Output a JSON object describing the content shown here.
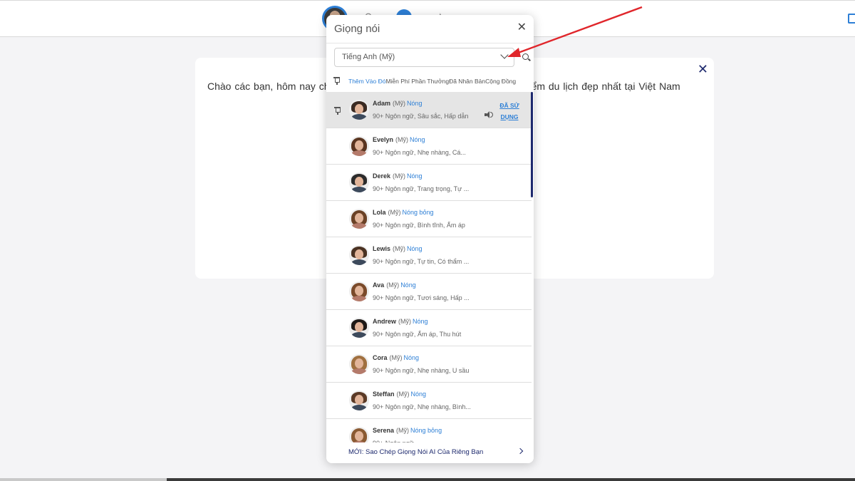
{
  "card": {
    "text": "Chào các bạn, hôm nay chúng ta sẽ cùng nhau khám phá những địa điểm du lịch đẹp nhất tại Việt Nam",
    "close_glyph": "✕"
  },
  "panel": {
    "title": "Giọng nói",
    "close_glyph": "✕",
    "language": "Tiếng Anh (Mỹ)",
    "filters": [
      "Thêm Vào Đó",
      "Miễn Phí",
      "Phần Thưởng",
      "Đã Nhân Bản",
      "Cộng Đồng"
    ],
    "footer": "MỚI: Sao Chép Giọng Nói AI Của Riêng Bạn"
  },
  "voices": [
    {
      "name": "Adam",
      "accent": "(Mỹ)",
      "tone": "Nóng",
      "desc": "90+ Ngôn ngữ, Sâu sắc, Hấp dẫn",
      "status": "ĐÃ SỬ DỤNG",
      "gender": "m",
      "hair": "#3a2a22"
    },
    {
      "name": "Evelyn",
      "accent": "(Mỹ)",
      "tone": "Nóng",
      "desc": "90+ Ngôn ngữ, Nhẹ nhàng, Cá...",
      "gender": "f",
      "hair": "#5a3520"
    },
    {
      "name": "Derek",
      "accent": "(Mỹ)",
      "tone": "Nóng",
      "desc": "90+ Ngôn ngữ, Trang trọng, Tự ...",
      "gender": "m",
      "hair": "#2b2b2b"
    },
    {
      "name": "Lola",
      "accent": "(Mỹ)",
      "tone": "Nóng bỏng",
      "desc": "90+ Ngôn ngữ, Bình tĩnh, Ấm áp",
      "gender": "f",
      "hair": "#6b4226"
    },
    {
      "name": "Lewis",
      "accent": "(Mỹ)",
      "tone": "Nóng",
      "desc": "90+ Ngôn ngữ, Tự tin, Có thẩm ...",
      "gender": "m",
      "hair": "#4a3222"
    },
    {
      "name": "Ava",
      "accent": "(Mỹ)",
      "tone": "Nóng",
      "desc": "90+ Ngôn ngữ, Tươi sáng, Hấp ...",
      "gender": "f",
      "hair": "#7a4a2a"
    },
    {
      "name": "Andrew",
      "accent": "(Mỹ)",
      "tone": "Nóng",
      "desc": "90+ Ngôn ngữ, Ấm áp, Thu hút",
      "gender": "m",
      "hair": "#1f1a17"
    },
    {
      "name": "Cora",
      "accent": "(Mỹ)",
      "tone": "Nóng",
      "desc": "90+ Ngôn ngữ, Nhẹ nhàng, U sầu",
      "gender": "f",
      "hair": "#a0703f"
    },
    {
      "name": "Steffan",
      "accent": "(Mỹ)",
      "tone": "Nóng",
      "desc": "90+ Ngôn ngữ, Nhẹ nhàng, Bình...",
      "gender": "m",
      "hair": "#5b3a26"
    },
    {
      "name": "Serena",
      "accent": "(Mỹ)",
      "tone": "Nóng bỏng",
      "desc": "90+ Ngôn ngữ",
      "gender": "f",
      "hair": "#8a5a32"
    }
  ],
  "colors": {
    "accent": "#2d7fd6",
    "navy": "#1e2a6e",
    "annotation": "#e0262b"
  }
}
